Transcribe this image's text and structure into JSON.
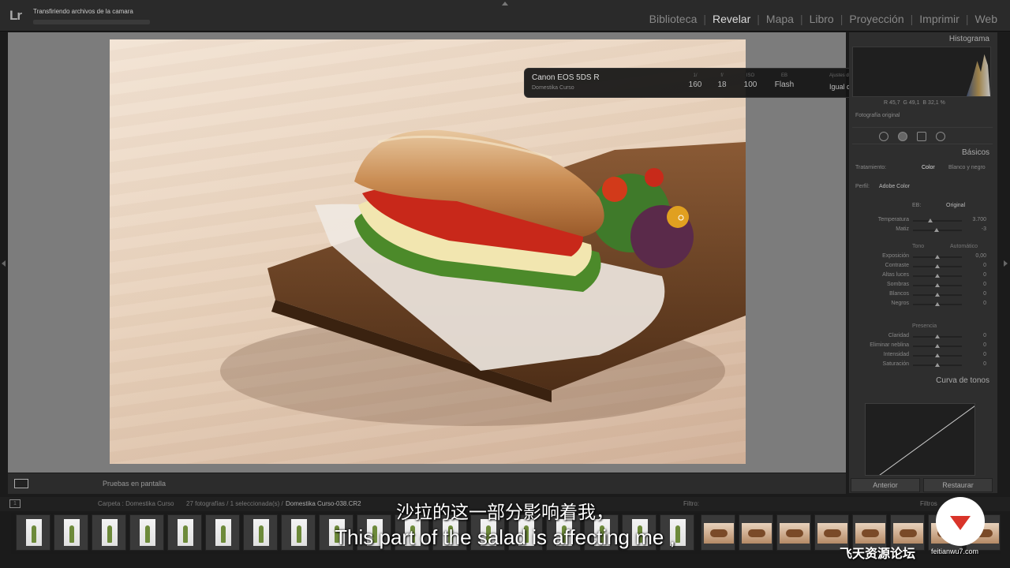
{
  "app": {
    "logo": "Lr",
    "status": "Transfiriendo archivos de la camara"
  },
  "modules": [
    "Biblioteca",
    "Revelar",
    "Mapa",
    "Libro",
    "Proyección",
    "Imprimir",
    "Web"
  ],
  "active_module": "Revelar",
  "info_overlay": {
    "camera": "Canon EOS 5DS R",
    "owner": "Domestika Curso",
    "exif": [
      {
        "label": "1/",
        "value": "160"
      },
      {
        "label": "f/",
        "value": "18"
      },
      {
        "label": "ISO",
        "value": "100"
      },
      {
        "label": "EB",
        "value": "Flash"
      }
    ],
    "preset_label": "Ajustes de revelado",
    "preset_value": "Igual que los ant..."
  },
  "right_panel": {
    "histogram_title": "Histograma",
    "rgb": {
      "r": "45,7",
      "g": "49,1",
      "b": "32,1"
    },
    "original_photo": "Fotografía original",
    "basic_title": "Básicos",
    "treatment_label": "Tratamiento:",
    "treatment_color": "Color",
    "treatment_bw": "Blanco y negro",
    "profile_label": "Perfil:",
    "profile_value": "Adobe Color",
    "wb_label": "EB:",
    "wb_value": "Original",
    "sliders_wb": [
      {
        "label": "Temperatura",
        "value": "3.700",
        "pos": 0.35
      },
      {
        "label": "Matiz",
        "value": "-3",
        "pos": 0.48
      }
    ],
    "tone_title": "Tono",
    "tone_auto": "Automático",
    "sliders_tone": [
      {
        "label": "Exposición",
        "value": "0,00",
        "pos": 0.5
      },
      {
        "label": "Contraste",
        "value": "0",
        "pos": 0.5
      },
      {
        "label": "Altas luces",
        "value": "0",
        "pos": 0.5
      },
      {
        "label": "Sombras",
        "value": "0",
        "pos": 0.5
      },
      {
        "label": "Blancos",
        "value": "0",
        "pos": 0.5
      },
      {
        "label": "Negros",
        "value": "0",
        "pos": 0.5
      }
    ],
    "presence_title": "Presencia",
    "sliders_presence": [
      {
        "label": "Claridad",
        "value": "0",
        "pos": 0.5
      },
      {
        "label": "Eliminar neblina",
        "value": "0",
        "pos": 0.5
      },
      {
        "label": "Intensidad",
        "value": "0",
        "pos": 0.5
      },
      {
        "label": "Saturación",
        "value": "0",
        "pos": 0.5
      }
    ],
    "curve_title": "Curva de tonos",
    "prev_button": "Anterior",
    "reset_button": "Restaurar"
  },
  "toolbar": {
    "soft_proof": "Pruebas en pantalla"
  },
  "filmstrip": {
    "page_num": "1",
    "path": "Carpeta : Domestika Curso",
    "count": "27 fotografías / 1 seleccionada(s) /",
    "file": "Domestika Curso-038.CR2",
    "filter_label": "Filtro:",
    "filter_label2": "Filtros"
  },
  "subtitles": {
    "cn": "沙拉的这一部分影响着我，",
    "en": "This part of the salad is affecting me ,"
  },
  "watermark": {
    "text": "飞天资源论坛",
    "url": "feitianwu7.com"
  }
}
